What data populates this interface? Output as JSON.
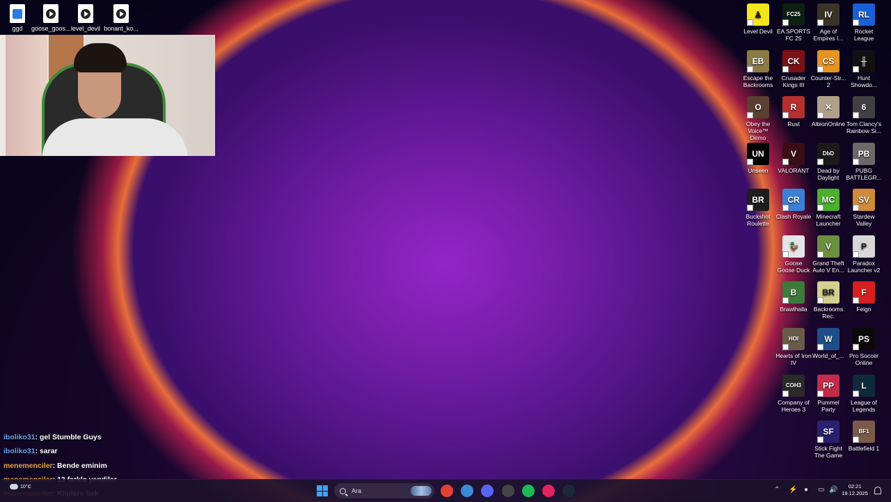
{
  "desktop_top": [
    {
      "label": "ggd",
      "kind": "blue"
    },
    {
      "label": "goose_goos...",
      "kind": "play"
    },
    {
      "label": "level_devil",
      "kind": "play"
    },
    {
      "label": "bonant_ko...",
      "kind": "play"
    }
  ],
  "apps": [
    {
      "label": "Level Devil",
      "color": "#f5e51b",
      "glyph": "♟"
    },
    {
      "label": "EA SPORTS FC 25",
      "color": "#0c2014",
      "glyph": "FC25"
    },
    {
      "label": "Age of Empires I...",
      "color": "#3c3327",
      "glyph": "IV"
    },
    {
      "label": "Rocket League",
      "color": "#1a5fd6",
      "glyph": "RL"
    },
    {
      "label": "Escape the Backrooms",
      "color": "#8b7a45",
      "glyph": "EB"
    },
    {
      "label": "Crusader Kings III",
      "color": "#7a1218",
      "glyph": "CK"
    },
    {
      "label": "Counter-Str... 2",
      "color": "#e69322",
      "glyph": "CS"
    },
    {
      "label": "Hunt Showdo...",
      "color": "#111111",
      "glyph": "╫"
    },
    {
      "label": "Obey the Voice™ Demo",
      "color": "#5a4030",
      "glyph": "O"
    },
    {
      "label": "Rust",
      "color": "#b5302c",
      "glyph": "R"
    },
    {
      "label": "AlbionOnline",
      "color": "#b0a08a",
      "glyph": "✕"
    },
    {
      "label": "Tom Clancy's Rainbow Si...",
      "color": "#404040",
      "glyph": "6"
    },
    {
      "label": "Unseen",
      "color": "#000000",
      "glyph": "UN"
    },
    {
      "label": "VALORANT",
      "color": "#3a0d17",
      "glyph": "V"
    },
    {
      "label": "Dead by Daylight",
      "color": "#1a1a1a",
      "glyph": "DbD"
    },
    {
      "label": "PUBG BATTLEGR...",
      "color": "#6a6a6a",
      "glyph": "PB"
    },
    {
      "label": "Buckshot Roulette",
      "color": "#1e1e1e",
      "glyph": "BR"
    },
    {
      "label": "Clash Royale",
      "color": "#3c7fd6",
      "glyph": "CR"
    },
    {
      "label": "Minecraft Launcher",
      "color": "#4caf2e",
      "glyph": "MC"
    },
    {
      "label": "Stardew Valley",
      "color": "#d08a3a",
      "glyph": "SV"
    },
    {
      "label": "Goose Goose Duck",
      "color": "#e5e5e5",
      "glyph": "🦆"
    },
    {
      "label": "Grand Theft Auto V En...",
      "color": "#6a8f3e",
      "glyph": "V"
    },
    {
      "label": "Paradox Launcher v2",
      "color": "#d8d8d8",
      "glyph": "P"
    },
    {
      "label": "Brawlhalla",
      "color": "#3e7a3a",
      "glyph": "B"
    },
    {
      "label": "Backrooms Rec.",
      "color": "#d5d090",
      "glyph": "BR"
    },
    {
      "label": "Feign",
      "color": "#d61f1f",
      "glyph": "F"
    },
    {
      "label": "Hearts of Iron IV",
      "color": "#6a5a48",
      "glyph": "HOI"
    },
    {
      "label": "World_of_...",
      "color": "#1e4e8a",
      "glyph": "W"
    },
    {
      "label": "Pro Soccer Online",
      "color": "#0a0a0a",
      "glyph": "PS"
    },
    {
      "label": "Company of Heroes 3",
      "color": "#2a2a2a",
      "glyph": "COH3"
    },
    {
      "label": "Pummel Party",
      "color": "#c42a4a",
      "glyph": "PP"
    },
    {
      "label": "League of Legends",
      "color": "#0f2a3a",
      "glyph": "L"
    },
    {
      "label": "Stick Fight The Game",
      "color": "#2a2070",
      "glyph": "SF"
    },
    {
      "label": "Battlefield 1",
      "color": "#7a5a48",
      "glyph": "BF1"
    }
  ],
  "chat": [
    {
      "user": "iboliko31",
      "msg": ": gel Stumble Guys",
      "color": "blue"
    },
    {
      "user": "iboliko31",
      "msg": ": sarar",
      "color": "blue"
    },
    {
      "user": "menemenciler",
      "msg": ": Bende eminim",
      "color": "orange"
    },
    {
      "user": "menemenciler",
      "msg": ": 13 farkla yendiler",
      "color": "orange"
    },
    {
      "user": "menemenciler",
      "msg": ": Kliplere bak",
      "color": "orange"
    }
  ],
  "taskbar": {
    "weather_temp": "10°C",
    "search_placeholder": "Ara",
    "time": "02:21",
    "date": "19.12.2025",
    "apps": [
      {
        "name": "chrome-icon",
        "color": "#e34133"
      },
      {
        "name": "app-icon",
        "color": "#3a8ad6"
      },
      {
        "name": "discord-icon",
        "color": "#5865f2"
      },
      {
        "name": "steam-alt-icon",
        "color": "#444444"
      },
      {
        "name": "spotify-icon",
        "color": "#1db954"
      },
      {
        "name": "tiktok-icon",
        "color": "#e0245e"
      },
      {
        "name": "steam-icon",
        "color": "#1b2838"
      }
    ]
  }
}
